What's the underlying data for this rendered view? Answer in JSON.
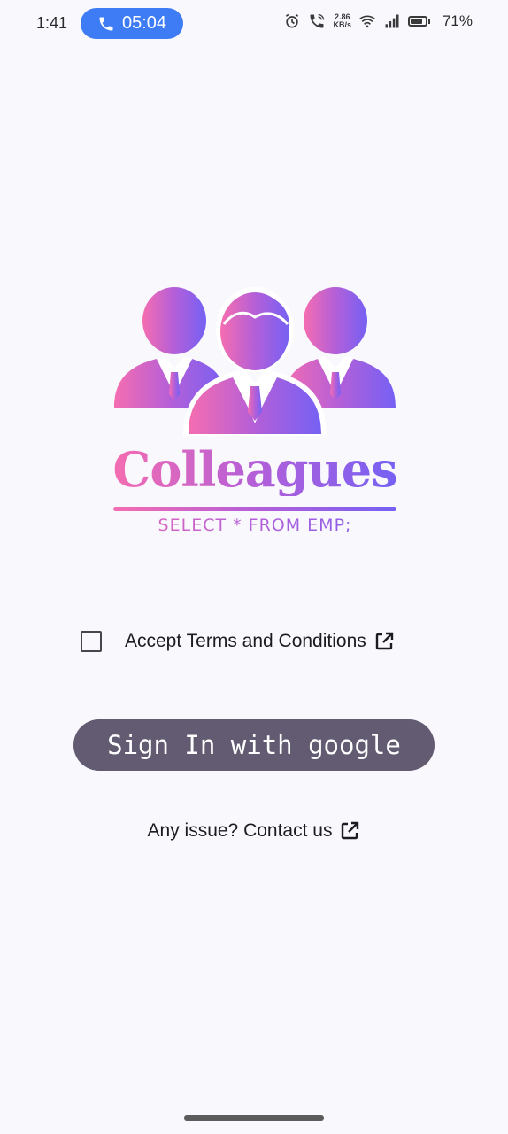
{
  "status_bar": {
    "time": "1:41",
    "call_duration": "05:04",
    "net_speed_value": "2.86",
    "net_speed_unit": "KB/s",
    "battery_percent": "71%",
    "battery_level": 0.71,
    "icons": [
      "phone-icon",
      "alarm-icon",
      "call-signal-icon",
      "wifi-icon",
      "signal-icon",
      "battery-icon"
    ]
  },
  "logo": {
    "wordmark": "Colleagues",
    "tagline": "SELECT * FROM EMP;",
    "gradient": [
      "#f56db0",
      "#b45fd8",
      "#7561f4"
    ]
  },
  "terms": {
    "label": "Accept Terms and Conditions",
    "checked": false,
    "icon": "open-in-new-icon"
  },
  "signin": {
    "label": "Sign In with google",
    "color": "#625b71"
  },
  "contact": {
    "label": "Any issue? Contact us",
    "icon": "open-in-new-icon"
  },
  "colors": {
    "background": "#f9f8fd",
    "call_pill": "#3d7cf5"
  }
}
